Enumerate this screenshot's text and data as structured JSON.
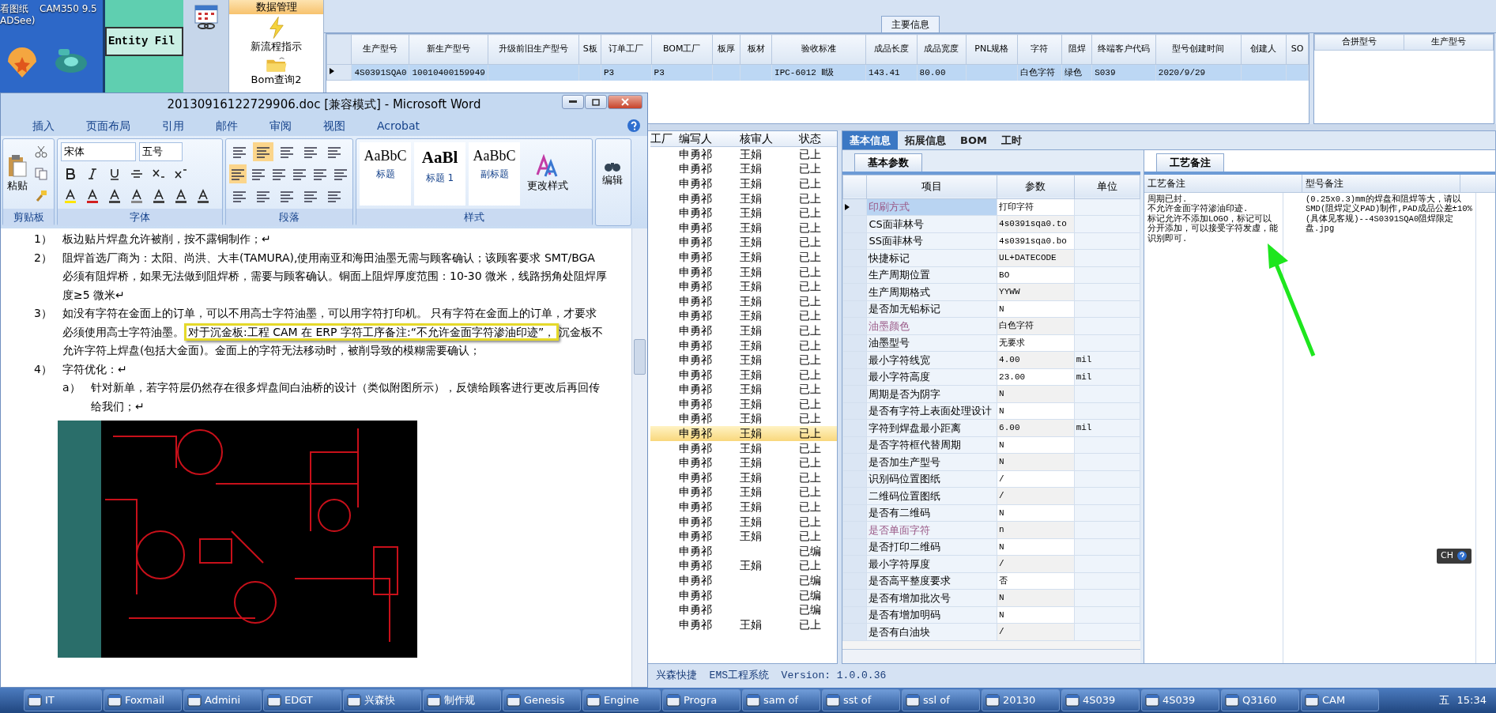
{
  "desktop_icons": [
    {
      "label": "看图纸\nADSee)"
    },
    {
      "label": "CAM350 9.5"
    }
  ],
  "cam_window": {
    "title": "Entity Fil"
  },
  "erp": {
    "nav": [
      {
        "label": "数据管理",
        "selected": true
      },
      {
        "label": "新流程指示",
        "selected": false
      },
      {
        "label": "Bom查询2",
        "selected": false
      }
    ],
    "main_info": {
      "title": "主要信息",
      "columns": [
        "生产型号",
        "新生产型号",
        "升级前旧生产型号",
        "S板",
        "订单工厂",
        "BOM工厂",
        "板厚",
        "板材",
        "验收标准",
        "成品长度",
        "成品宽度",
        "PNL规格",
        "字符",
        "阻焊",
        "终端客户代码",
        "型号创建时间",
        "创建人",
        "SO"
      ],
      "rows": [
        {
          "selected": true,
          "cells": [
            "4S0391SQA0",
            "10010400159949",
            null,
            null,
            "P3",
            "P3",
            null,
            null,
            "IPC-6012 Ⅱ级",
            "143.41",
            "80.00",
            null,
            "白色字符",
            "绿色",
            "S039",
            "2020/9/29",
            null,
            null
          ]
        }
      ]
    },
    "merge_table": {
      "columns": [
        "合拼型号",
        "生产型号"
      ]
    },
    "list": {
      "columns": [
        "工厂",
        "编写人",
        "核审人",
        "状态"
      ],
      "rows": [
        {
          "writer": "申勇祁",
          "reviewer": "王娟",
          "status": "已上",
          "selected": false
        },
        {
          "writer": "申勇祁",
          "reviewer": "王娟",
          "status": "已上",
          "selected": false
        },
        {
          "writer": "申勇祁",
          "reviewer": "王娟",
          "status": "已上",
          "selected": false
        },
        {
          "writer": "申勇祁",
          "reviewer": "王娟",
          "status": "已上",
          "selected": false
        },
        {
          "writer": "申勇祁",
          "reviewer": "王娟",
          "status": "已上",
          "selected": false
        },
        {
          "writer": "申勇祁",
          "reviewer": "王娟",
          "status": "已上",
          "selected": false
        },
        {
          "writer": "申勇祁",
          "reviewer": "王娟",
          "status": "已上",
          "selected": false
        },
        {
          "writer": "申勇祁",
          "reviewer": "王娟",
          "status": "已上",
          "selected": false
        },
        {
          "writer": "申勇祁",
          "reviewer": "王娟",
          "status": "已上",
          "selected": false
        },
        {
          "writer": "申勇祁",
          "reviewer": "王娟",
          "status": "已上",
          "selected": false
        },
        {
          "writer": "申勇祁",
          "reviewer": "王娟",
          "status": "已上",
          "selected": false
        },
        {
          "writer": "申勇祁",
          "reviewer": "王娟",
          "status": "已上",
          "selected": false
        },
        {
          "writer": "申勇祁",
          "reviewer": "王娟",
          "status": "已上",
          "selected": false
        },
        {
          "writer": "申勇祁",
          "reviewer": "王娟",
          "status": "已上",
          "selected": false
        },
        {
          "writer": "申勇祁",
          "reviewer": "王娟",
          "status": "已上",
          "selected": false
        },
        {
          "writer": "申勇祁",
          "reviewer": "王娟",
          "status": "已上",
          "selected": false
        },
        {
          "writer": "申勇祁",
          "reviewer": "王娟",
          "status": "已上",
          "selected": false
        },
        {
          "writer": "申勇祁",
          "reviewer": "王娟",
          "status": "已上",
          "selected": false
        },
        {
          "writer": "申勇祁",
          "reviewer": "王娟",
          "status": "已上",
          "selected": false
        },
        {
          "writer": "申勇祁",
          "reviewer": "王娟",
          "status": "已上",
          "selected": true
        },
        {
          "writer": "申勇祁",
          "reviewer": "王娟",
          "status": "已上",
          "selected": false
        },
        {
          "writer": "申勇祁",
          "reviewer": "王娟",
          "status": "已上",
          "selected": false
        },
        {
          "writer": "申勇祁",
          "reviewer": "王娟",
          "status": "已上",
          "selected": false
        },
        {
          "writer": "申勇祁",
          "reviewer": "王娟",
          "status": "已上",
          "selected": false
        },
        {
          "writer": "申勇祁",
          "reviewer": "王娟",
          "status": "已上",
          "selected": false
        },
        {
          "writer": "申勇祁",
          "reviewer": "王娟",
          "status": "已上",
          "selected": false
        },
        {
          "writer": "申勇祁",
          "reviewer": "王娟",
          "status": "已上",
          "selected": false
        },
        {
          "writer": "申勇祁",
          "status": "已编",
          "selected": false
        },
        {
          "writer": "申勇祁",
          "reviewer": "王娟",
          "status": "已上",
          "selected": false
        },
        {
          "writer": "申勇祁",
          "status": "已编",
          "selected": false
        },
        {
          "writer": "申勇祁",
          "status": "已编",
          "selected": false
        },
        {
          "writer": "申勇祁",
          "status": "已编",
          "selected": false
        },
        {
          "writer": "申勇祁",
          "reviewer": "王娟",
          "status": "已上",
          "selected": false
        }
      ]
    },
    "detail_tabs": [
      {
        "label": "基本信息",
        "selected": true
      },
      {
        "label": "拓展信息",
        "selected": false
      },
      {
        "label": "BOM",
        "selected": false
      },
      {
        "label": "工时",
        "selected": false
      }
    ],
    "param_tab": "基本参数",
    "params": {
      "columns": [
        "项目",
        "参数",
        "单位"
      ],
      "rows": [
        {
          "item": "印刷方式",
          "value": "打印字符",
          "emphasized": true,
          "selected": true
        },
        {
          "item": "CS面菲林号",
          "value": "4s0391sqa0.to",
          "emphasized": false,
          "selected": false
        },
        {
          "item": "SS面菲林号",
          "value": "4s0391sqa0.bo",
          "emphasized": false,
          "selected": false
        },
        {
          "item": "快捷标记",
          "value": "UL+DATECODE",
          "emphasized": false,
          "selected": false
        },
        {
          "item": "生产周期位置",
          "value": "BO",
          "emphasized": false,
          "selected": false
        },
        {
          "item": "生产周期格式",
          "value": "YYWW",
          "emphasized": false,
          "selected": false
        },
        {
          "item": "是否加无铅标记",
          "value": "N",
          "emphasized": false,
          "selected": false
        },
        {
          "item": "油墨颜色",
          "value": "白色字符",
          "emphasized": true,
          "selected": false
        },
        {
          "item": "油墨型号",
          "value": "无要求",
          "emphasized": false,
          "selected": false
        },
        {
          "item": "最小字符线宽",
          "value": "4.00",
          "unit": "mil",
          "emphasized": false,
          "selected": false
        },
        {
          "item": "最小字符高度",
          "value": "23.00",
          "unit": "mil",
          "emphasized": false,
          "selected": false
        },
        {
          "item": "周期是否为阴字",
          "value": "N",
          "emphasized": false,
          "selected": false
        },
        {
          "item": "是否有字符上表面处理设计",
          "value": "N",
          "emphasized": false,
          "selected": false
        },
        {
          "item": "字符到焊盘最小距离",
          "value": "6.00",
          "unit": "mil",
          "emphasized": false,
          "selected": false
        },
        {
          "item": "是否字符框代替周期",
          "value": "N",
          "emphasized": false,
          "selected": false
        },
        {
          "item": "是否加生产型号",
          "value": "N",
          "emphasized": false,
          "selected": false
        },
        {
          "item": "识别码位置图纸",
          "value": "/",
          "emphasized": false,
          "selected": false
        },
        {
          "item": "二维码位置图纸",
          "value": "/",
          "emphasized": false,
          "selected": false
        },
        {
          "item": "是否有二维码",
          "value": "N",
          "emphasized": false,
          "selected": false
        },
        {
          "item": "是否单面字符",
          "value": "n",
          "emphasized": true,
          "selected": false
        },
        {
          "item": "是否打印二维码",
          "value": "N",
          "emphasized": false,
          "selected": false
        },
        {
          "item": "最小字符厚度",
          "value": "/",
          "emphasized": false,
          "selected": false
        },
        {
          "item": "是否高平整度要求",
          "value": "否",
          "emphasized": false,
          "selected": false
        },
        {
          "item": "是否有增加批次号",
          "value": "N",
          "emphasized": false,
          "selected": false
        },
        {
          "item": "是否有增加明码",
          "value": "N",
          "emphasized": false,
          "selected": false
        },
        {
          "item": "是否有白油块",
          "value": "/",
          "emphasized": false,
          "selected": false
        }
      ]
    },
    "notes": {
      "tab": "工艺备注",
      "columns": [
        "工艺备注",
        "型号备注"
      ],
      "process_note": "周期已封.\n不允许金面字符渗油印迹.\n标记允许不添加LOGO，标记可以分开添加，可以接受字符发虚，能识别即可.",
      "model_note": "(0.25x0.3)mm的焊盘和阻焊等大，请以SMD(阻焊定义PAD)制作,PAD成品公差±10%(具体见客规)--4S0391SQA0阻焊限定盘.jpg"
    },
    "status_bar": "兴森快捷  EMS工程系统  Version: 1.0.0.36"
  },
  "word": {
    "title": "20130916122729906.doc [兼容模式] - Microsoft Word",
    "tabs": [
      "插入",
      "页面布局",
      "引用",
      "邮件",
      "审阅",
      "视图",
      "Acrobat"
    ],
    "paste": "粘贴",
    "font": "宋体",
    "size": "五号",
    "groups": [
      "剪贴板",
      "字体",
      "段落",
      "样式"
    ],
    "styles": [
      {
        "preview": "AaBbC",
        "label": "标题",
        "bold": false
      },
      {
        "preview": "AaBl",
        "label": "标题 1",
        "bold": true
      },
      {
        "preview": "AaBbC",
        "label": "副标题",
        "bold": false
      }
    ],
    "change_styles": "更改样式",
    "editing": "编辑",
    "paragraphs": [
      {
        "kind": "plain",
        "marker": "1）",
        "text": "板边贴片焊盘允许被削，按不露铜制作；↵"
      },
      {
        "kind": "plain",
        "marker": "2）",
        "text": "阻焊首选厂商为：太阳、尚洪、大丰(TAMURA),使用南亚和海田油墨无需与顾客确认；该顾客要求 SMT/BGA 必须有阻焊桥，如果无法做到阻焊桥，需要与顾客确认。铜面上阻焊厚度范围：10-30 微米，线路拐角处阻焊厚度≥5 微米↵"
      },
      {
        "kind": "callout",
        "marker": "3）",
        "before": "如没有字符在金面上的订单，可以不用高士字符油墨，可以用字符打印机。 只有字符在金面上的订单，才要求必须使用高士字符油墨。",
        "highlight": "对于沉金板:工程 CAM 在 ERP 字符工序备注:“不允许金面字符渗油印迹”，",
        "after": "沉金板不允许字符上焊盘(包括大金面)。金面上的字符无法移动时，被削导致的模糊需要确认；"
      },
      {
        "kind": "plain",
        "marker": "4）",
        "text": "字符优化：↵"
      },
      {
        "kind": "sub",
        "marker": "a）",
        "text": "针对新单，若字符层仍然存在很多焊盘间白油桥的设计（类似附图所示），反馈给顾客进行更改后再回传给我们；↵"
      }
    ]
  },
  "taskbar": {
    "items": [
      "IT",
      "Foxmail",
      "Admini",
      "EDGT",
      "兴森快",
      "制作规",
      "Genesis",
      "Engine",
      "Progra",
      "sam of",
      "sst of",
      "ssl of",
      "20130",
      "4S039",
      "4S039",
      "Q3160",
      "CAM"
    ],
    "ime": "五",
    "language": "CH",
    "clock": "15:34"
  }
}
